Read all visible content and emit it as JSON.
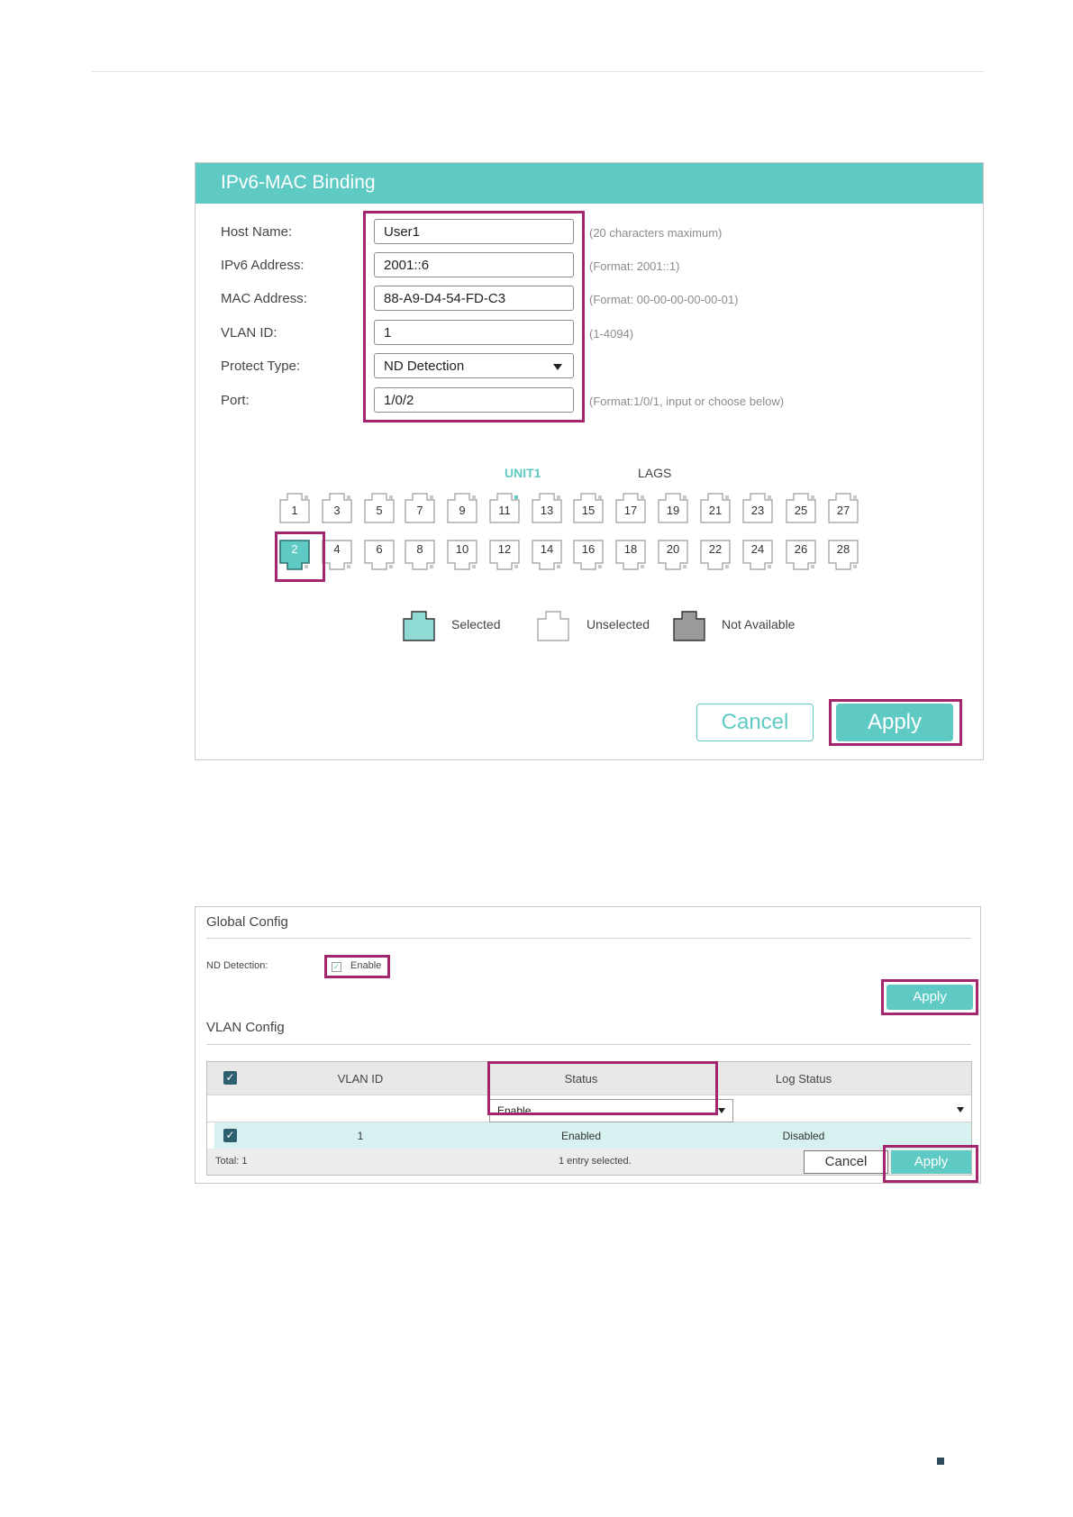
{
  "binding": {
    "title": "IPv6-MAC Binding",
    "fields": [
      {
        "label": "Host Name:",
        "value": "User1",
        "hint": "(20 characters maximum)"
      },
      {
        "label": "IPv6 Address:",
        "value": "2001::6",
        "hint": "(Format: 2001::1)"
      },
      {
        "label": "MAC Address:",
        "value": "88-A9-D4-54-FD-C3",
        "hint": "(Format: 00-00-00-00-00-01)"
      },
      {
        "label": "VLAN ID:",
        "value": "1",
        "hint": "(1-4094)"
      },
      {
        "label": "Protect Type:",
        "value": "ND Detection",
        "hint": ""
      },
      {
        "label": "Port:",
        "value": "1/0/2",
        "hint": "(Format:1/0/1, input or choose below)"
      }
    ],
    "unit_label": "UNIT1",
    "lags_label": "LAGS",
    "ports_top": [
      "1",
      "3",
      "5",
      "7",
      "9",
      "11",
      "13",
      "15",
      "17",
      "19",
      "21",
      "23",
      "25",
      "27"
    ],
    "ports_bottom": [
      "2",
      "4",
      "6",
      "8",
      "10",
      "12",
      "14",
      "16",
      "18",
      "20",
      "22",
      "24",
      "26",
      "28"
    ],
    "selected_port": "2",
    "legend": {
      "selected": "Selected",
      "unselected": "Unselected",
      "not_available": "Not Available"
    },
    "cancel_label": "Cancel",
    "apply_label": "Apply"
  },
  "nd": {
    "global_title": "Global Config",
    "nd_detection_label": "ND Detection:",
    "enable_label": "Enable",
    "enable_checked": true,
    "apply_label": "Apply",
    "vlan_title": "VLAN Config",
    "table": {
      "headers": [
        "VLAN ID",
        "Status",
        "Log Status"
      ],
      "status_filter": "Enable",
      "rows": [
        {
          "vlan_id": "1",
          "status": "Enabled",
          "log_status": "Disabled"
        }
      ],
      "total_label": "Total: 1",
      "selected_label": "1 entry selected.",
      "cancel_label": "Cancel",
      "apply_label": "Apply"
    }
  },
  "colors": {
    "accent": "#5fcac4",
    "highlight": "#a3256b",
    "checkbox": "#2e5f6f"
  }
}
